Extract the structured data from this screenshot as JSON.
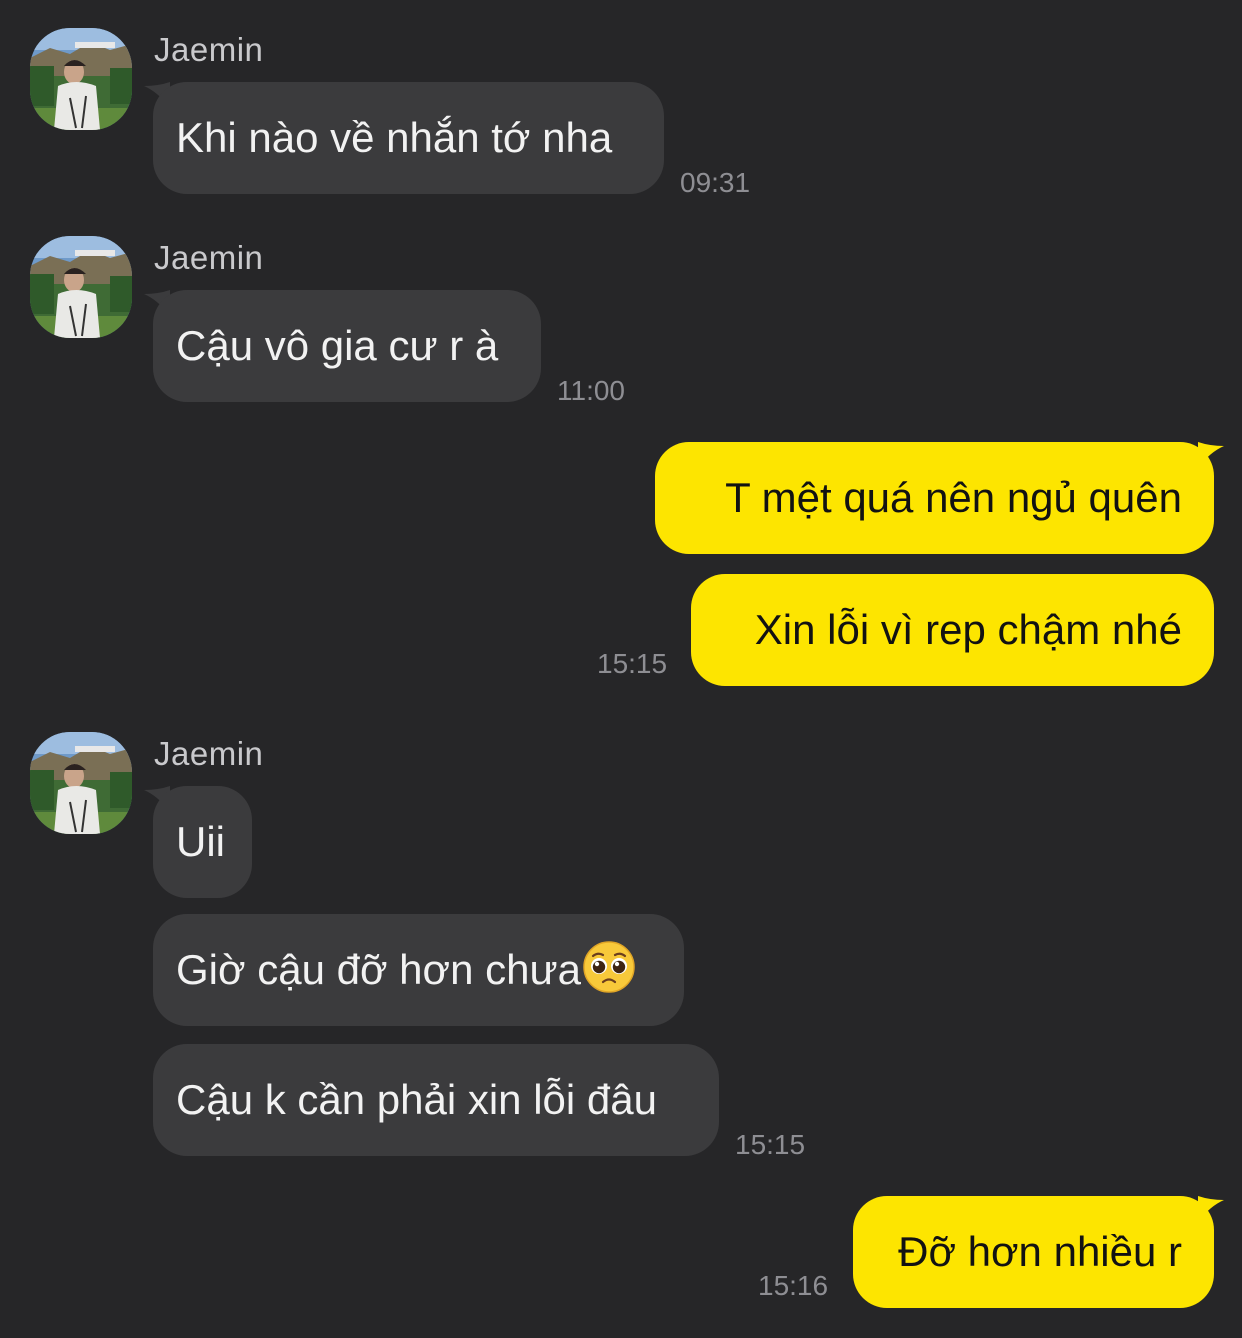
{
  "colors": {
    "background": "#262628",
    "incoming_bubble": "#3b3b3d",
    "outgoing_bubble": "#fde500",
    "timestamp": "#8e8e93"
  },
  "messages": [
    {
      "sender": "Jaemin",
      "text": "Khi nào về nhắn tớ nha",
      "time": "09:31"
    },
    {
      "sender": "Jaemin",
      "text": "Cậu vô gia cư r à",
      "time": "11:00"
    },
    {
      "text": "T mệt quá nên ngủ quên"
    },
    {
      "text": "Xin lỗi vì rep chậm nhé",
      "time": "15:15"
    },
    {
      "sender": "Jaemin",
      "text": "Uii"
    },
    {
      "text": "Giờ cậu đỡ hơn chưa",
      "emoji": "pleading-face-icon"
    },
    {
      "text": "Cậu k cần phải xin lỗi đâu",
      "time": "15:15"
    },
    {
      "text": "Đỡ hơn nhiều r",
      "time": "15:16"
    }
  ]
}
